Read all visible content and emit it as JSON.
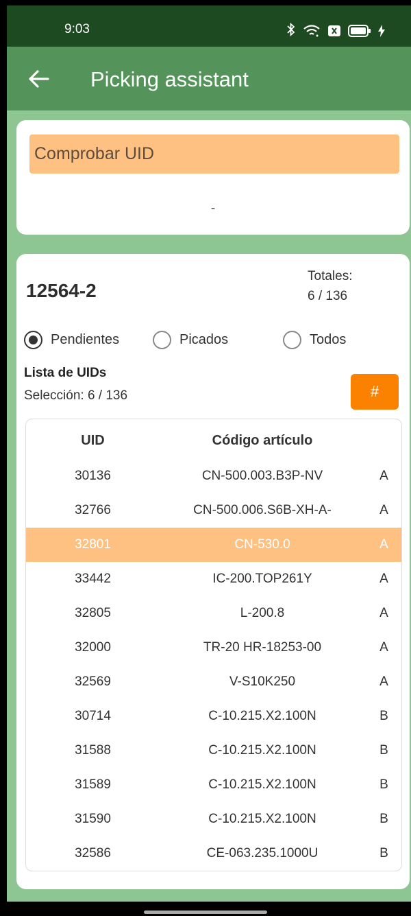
{
  "status_bar": {
    "time": "9:03",
    "icons": [
      "bluetooth-icon",
      "wifi-icon",
      "sim-icon",
      "battery-icon",
      "charging-icon"
    ]
  },
  "app_bar": {
    "title": "Picking assistant",
    "back_icon": "arrow-left-icon"
  },
  "check_card": {
    "input_placeholder": "Comprobar UID",
    "result": "-"
  },
  "list_card": {
    "order_id": "12564-2",
    "totals_label": "Totales:",
    "totals_value": "6 / 136",
    "filters": [
      {
        "label": "Pendientes",
        "checked": true
      },
      {
        "label": "Picados",
        "checked": false
      },
      {
        "label": "Todos",
        "checked": false
      }
    ],
    "list_title": "Lista de UIDs",
    "selection_label": "Selección:",
    "selection_value": "6 / 136",
    "hash_button_label": "#"
  },
  "table": {
    "columns": [
      "UID",
      "Código artículo",
      ""
    ],
    "rows": [
      {
        "uid": "30136",
        "code": "CN-500.003.B3P-NV",
        "zone": "A",
        "selected": false
      },
      {
        "uid": "32766",
        "code": "CN-500.006.S6B-XH-A-",
        "zone": "A",
        "selected": false
      },
      {
        "uid": "32801",
        "code": "CN-530.0",
        "zone": "A",
        "selected": true
      },
      {
        "uid": "33442",
        "code": "IC-200.TOP261Y",
        "zone": "A",
        "selected": false
      },
      {
        "uid": "32805",
        "code": "L-200.8",
        "zone": "A",
        "selected": false
      },
      {
        "uid": "32000",
        "code": "TR-20 HR-18253-00",
        "zone": "A",
        "selected": false
      },
      {
        "uid": "32569",
        "code": "V-S10K250",
        "zone": "A",
        "selected": false
      },
      {
        "uid": "30714",
        "code": "C-10.215.X2.100N",
        "zone": "B",
        "selected": false
      },
      {
        "uid": "31588",
        "code": "C-10.215.X2.100N",
        "zone": "B",
        "selected": false
      },
      {
        "uid": "31589",
        "code": "C-10.215.X2.100N",
        "zone": "B",
        "selected": false
      },
      {
        "uid": "31590",
        "code": "C-10.215.X2.100N",
        "zone": "B",
        "selected": false
      },
      {
        "uid": "32586",
        "code": "CE-063.235.1000U",
        "zone": "B",
        "selected": false
      }
    ]
  },
  "colors": {
    "status_bar": "#1e4a22",
    "app_bar": "#54935a",
    "background": "#8dc593",
    "input_bg": "#ffc182",
    "accent_button": "#fb8100",
    "selected_row": "#ffc182"
  }
}
